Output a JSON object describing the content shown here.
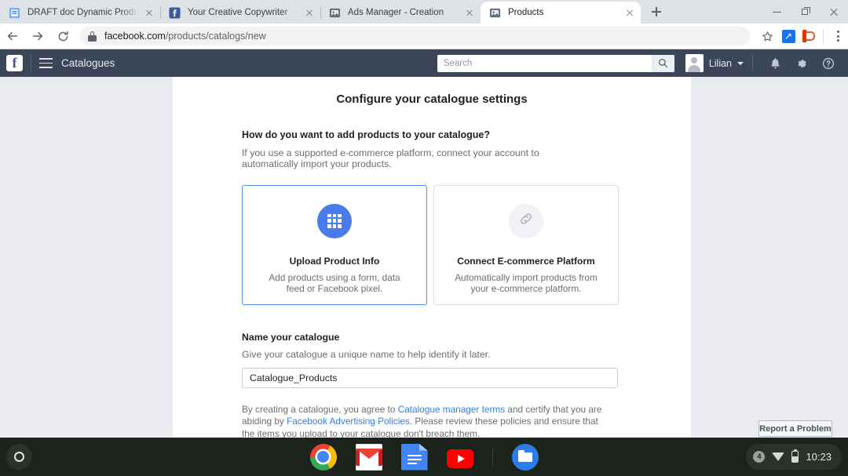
{
  "browser": {
    "tabs": [
      {
        "title": "DRAFT doc Dynamic Product Ads",
        "favicon": "docs-icon",
        "active": false
      },
      {
        "title": "Your Creative Copywriter",
        "favicon": "facebook-icon",
        "active": false
      },
      {
        "title": "Ads Manager - Creation",
        "favicon": "facebook-page-icon",
        "active": false
      },
      {
        "title": "Products",
        "favicon": "facebook-page-icon",
        "active": true
      }
    ],
    "new_tab_label": "+",
    "window_controls": {
      "minimize": "–",
      "maximize": "□",
      "close": "×"
    },
    "nav": {
      "back": "←",
      "forward": "→",
      "reload": "⟳"
    },
    "address": {
      "host": "facebook.com",
      "path": "/products/catalogs/new",
      "secure_icon": "lock-icon"
    },
    "actions": {
      "bookmark": "☆",
      "extension_screenshot": "screenshot-extension-icon",
      "extension_office": "office-extension-icon",
      "menu": "kebab-menu-icon"
    }
  },
  "fb_header": {
    "logo": "f",
    "menu_icon": "hamburger-icon",
    "title": "Catalogues",
    "search": {
      "placeholder": "Search",
      "value": "",
      "button_icon": "search-icon"
    },
    "user": {
      "name": "Lilian",
      "caret": "▾",
      "avatar": "user-avatar"
    },
    "icons": {
      "notifications": "bell-icon",
      "settings": "gear-icon",
      "help": "help-icon"
    }
  },
  "main": {
    "page_title": "Configure your catalogue settings",
    "add_products": {
      "heading": "How do you want to add products to your catalogue?",
      "description": "If you use a supported e-commerce platform, connect your account to automatically import your products.",
      "options": [
        {
          "title": "Upload Product Info",
          "description": "Add products using a form, data feed or Facebook pixel.",
          "icon": "grid-icon",
          "selected": true
        },
        {
          "title": "Connect E-commerce Platform",
          "description": "Automatically import products from your e-commerce platform.",
          "icon": "link-icon",
          "selected": false
        }
      ]
    },
    "name_field": {
      "label": "Name your catalogue",
      "hint": "Give your catalogue a unique name to help identify it later.",
      "value": "Catalogue_Products",
      "placeholder": ""
    },
    "legal": {
      "part1": "By creating a catalogue, you agree to ",
      "link1": "Catalogue manager terms",
      "part2": " and certify that you are abiding by ",
      "link2": "Facebook Advertising Policies",
      "part3": ". Please review these policies and ensure that the items you upload to your catalogue don't breach them."
    },
    "report_button": "Report a Problem"
  },
  "shelf": {
    "launcher": "launcher-icon",
    "apps": [
      {
        "name": "chrome-icon"
      },
      {
        "name": "gmail-icon"
      },
      {
        "name": "google-docs-icon"
      },
      {
        "name": "youtube-icon"
      },
      {
        "name": "files-icon"
      }
    ],
    "tray": {
      "badge": "4",
      "wifi": "wifi-icon",
      "battery": "battery-icon",
      "time": "10:23"
    }
  },
  "colors": {
    "fb_header_bg": "#3b4758",
    "page_bg": "#e9ebee",
    "accent_blue": "#4a7aeb",
    "link_blue": "#3b7bd4",
    "selected_border": "#4a90e2",
    "shelf_bg": "#1c231c"
  }
}
